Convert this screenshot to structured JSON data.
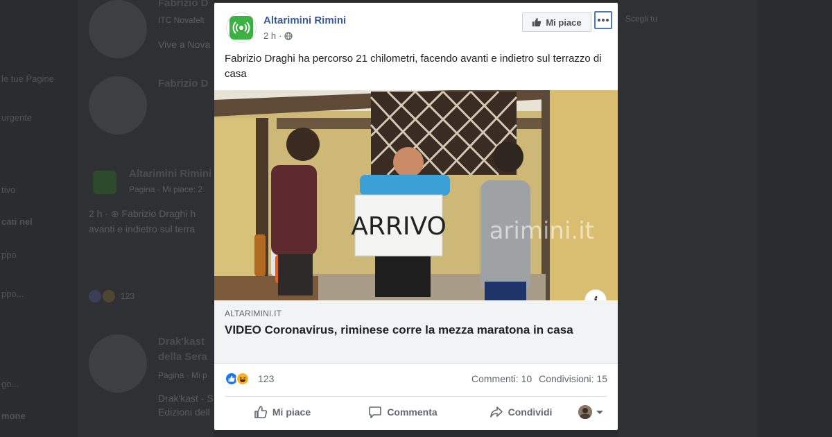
{
  "background": {
    "feed": [
      {
        "title": "Fabrizio D",
        "line1": "ITC Novafelt",
        "line2": "Vive a Nova"
      },
      {
        "title": "Fabrizio D"
      },
      {
        "title": "Altarimini Rimini",
        "line1": "Pagina · Mi piace: 2",
        "line2": "2 h · ⊕ Fabrizio Draghi h",
        "line3": "avanti e indietro sul terra",
        "count": "123"
      },
      {
        "title": "Drak'kast",
        "title2": "della Sera",
        "line1": "Pagina · Mi p",
        "line2": "Drak'kast - S",
        "line3": "Edizioni dell"
      }
    ],
    "left_menu": [
      "le tue Pagine",
      "urgente",
      "tivo",
      "cati nel",
      "ppo",
      "ppo...",
      "go...",
      "mone"
    ],
    "right_text": "Scegli tu"
  },
  "post": {
    "page_name": "Altarimini Rimini",
    "time": "2 h",
    "like_page_label": "Mi piace",
    "text": "Fabrizio Draghi ha percorso 21 chilometri, facendo avanti e indietro sul terrazzo di casa",
    "image_sign": "ARRIVO",
    "image_watermark": "arimini.it",
    "link": {
      "domain": "ALTARIMINI.IT",
      "title": "VIDEO Coronavirus, riminese corre la mezza maratona in casa"
    },
    "reactions_count": "123",
    "comments": "Commenti: 10",
    "shares": "Condivisioni: 15",
    "actions": {
      "like": "Mi piace",
      "comment": "Commenta",
      "share": "Condividi"
    }
  },
  "colors": {
    "brand_blue": "#385898",
    "like_blue": "#1877f2",
    "haha_yellow": "#f7b125",
    "logo_green": "#3cb043"
  },
  "icons": [
    "globe-icon",
    "thumbs-up-icon",
    "more-icon",
    "info-icon",
    "comment-icon",
    "share-icon",
    "caret-down-icon"
  ]
}
